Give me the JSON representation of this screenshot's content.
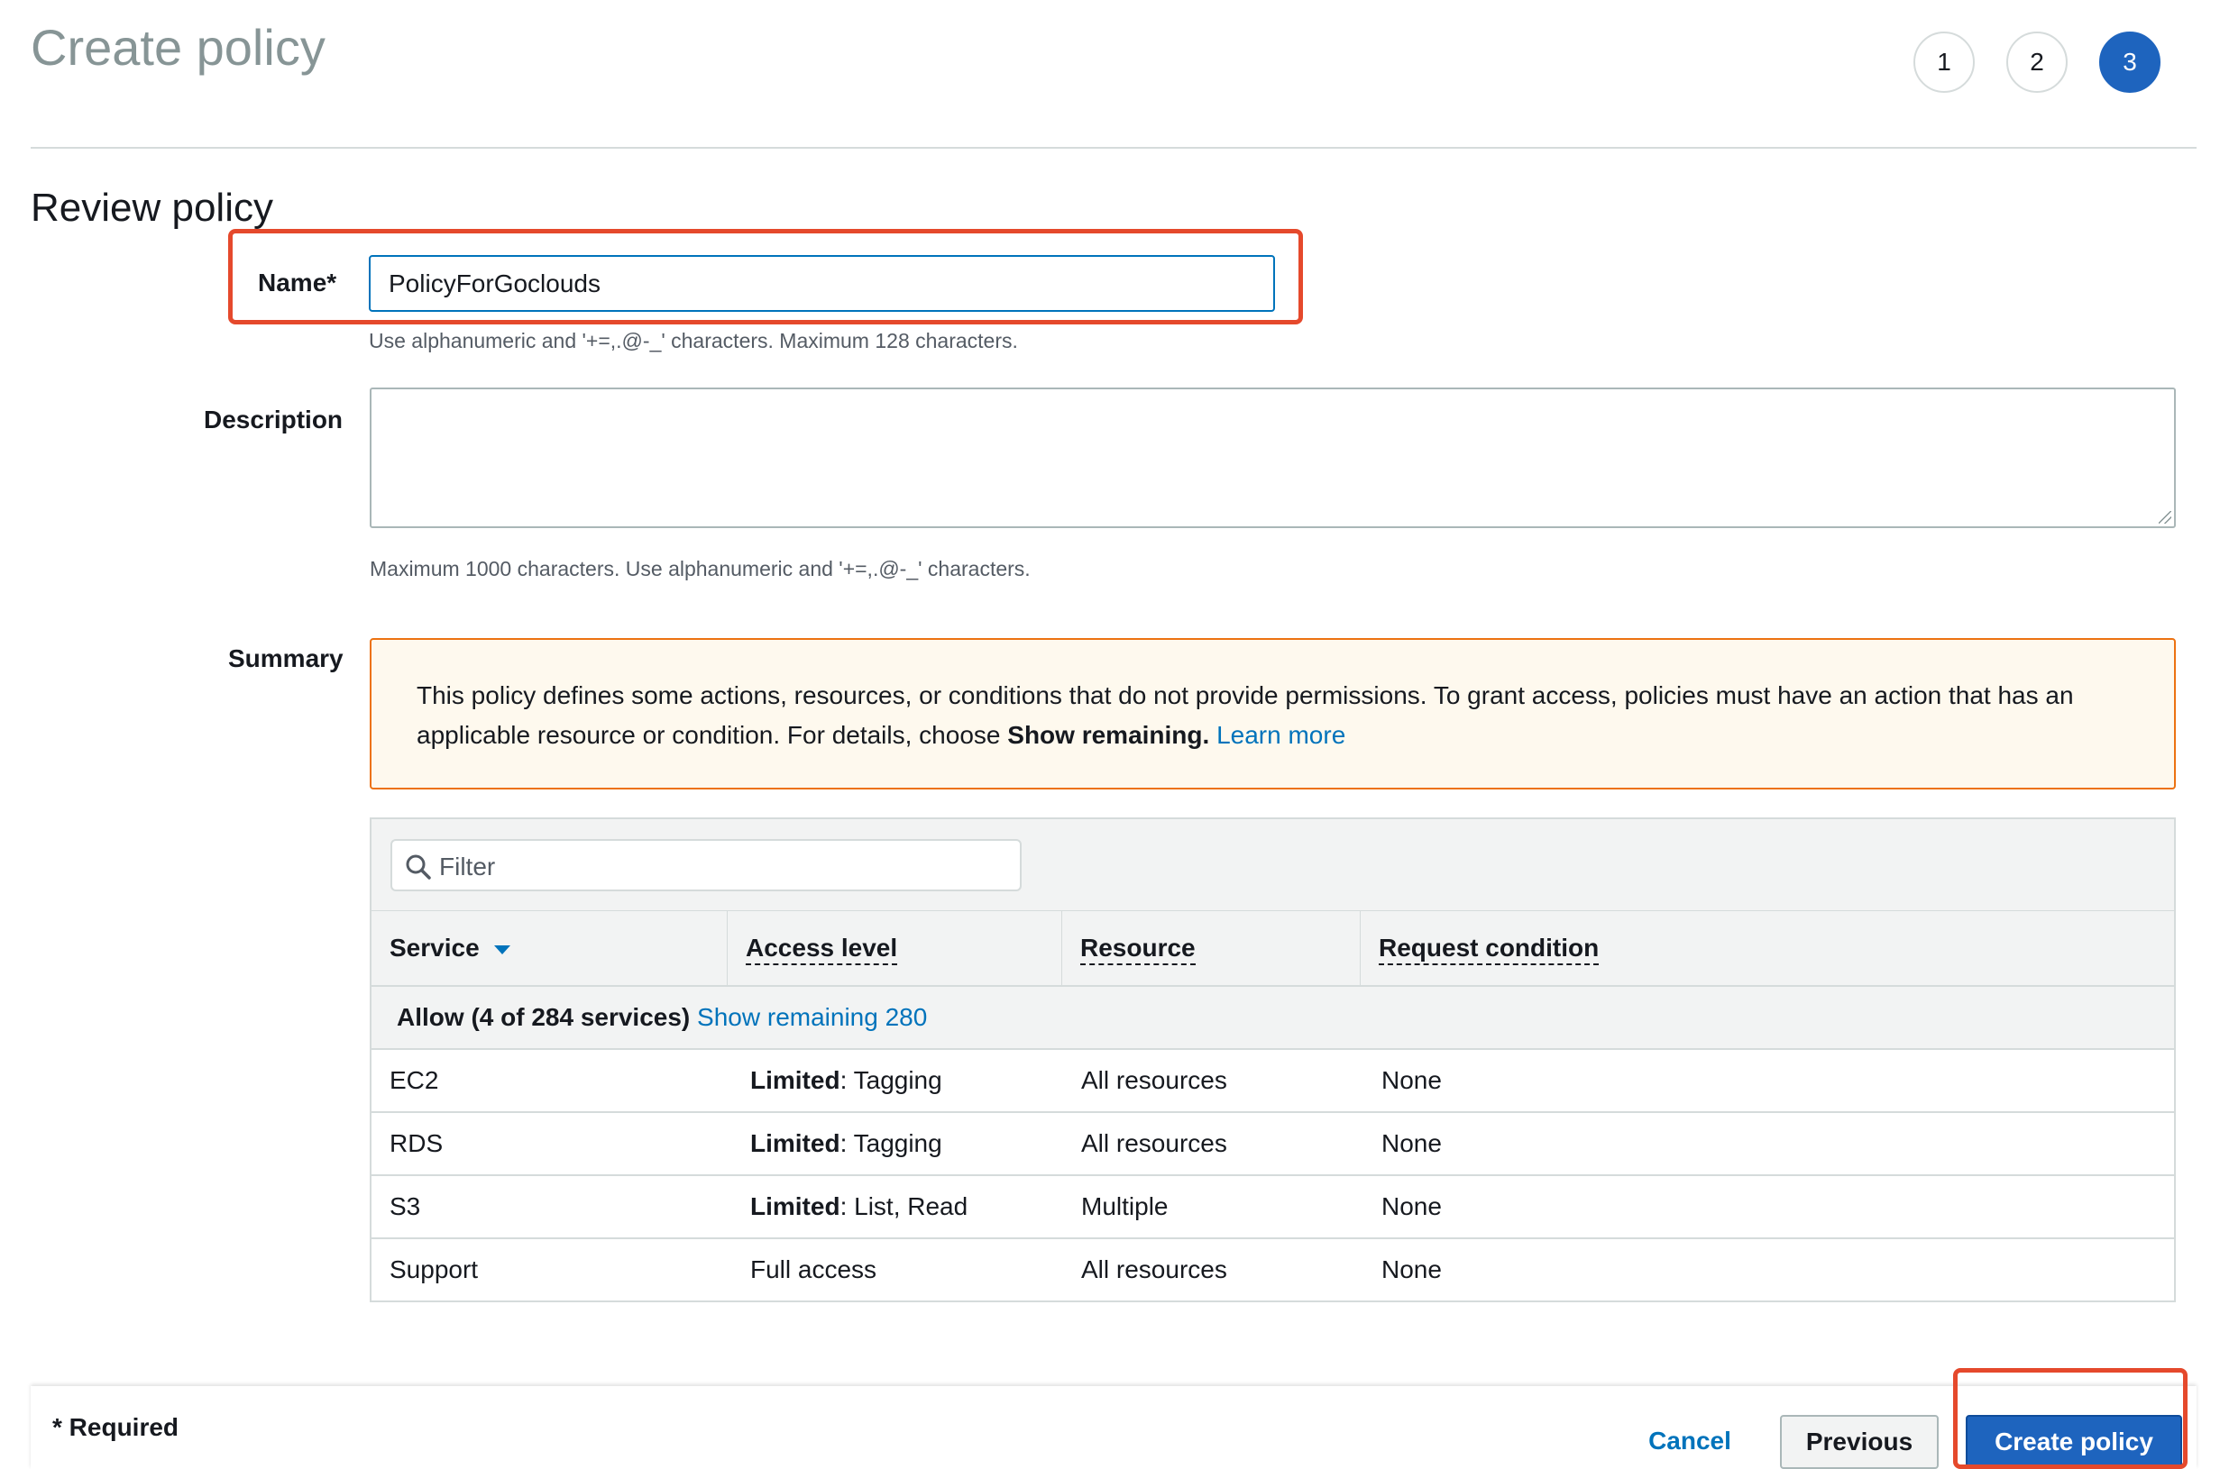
{
  "page": {
    "title": "Create policy"
  },
  "steps": [
    "1",
    "2",
    "3"
  ],
  "active_step": "3",
  "review": {
    "title": "Review policy",
    "name_label": "Name*",
    "name_value": "PolicyForGoclouds",
    "name_hint": "Use alphanumeric and '+=,.@-_' characters. Maximum 128 characters.",
    "description_label": "Description",
    "description_value": "",
    "description_hint": "Maximum 1000 characters. Use alphanumeric and '+=,.@-_' characters.",
    "summary_label": "Summary"
  },
  "warning": {
    "text_before": "This policy defines some actions, resources, or conditions that do not provide permissions. To grant access, policies must have an action that has an applicable resource or condition. For details, choose ",
    "bold": "Show remaining.",
    "link": "Learn more"
  },
  "table": {
    "filter_placeholder": "Filter",
    "columns": [
      "Service",
      "Access level",
      "Resource",
      "Request condition"
    ],
    "group": {
      "label": "Allow (4 of 284 services)",
      "link": "Show remaining 280"
    },
    "rows": [
      {
        "service": "EC2",
        "access_bold": "Limited",
        "access_rest": ": Tagging",
        "resource": "All resources",
        "condition": "None"
      },
      {
        "service": "RDS",
        "access_bold": "Limited",
        "access_rest": ": Tagging",
        "resource": "All resources",
        "condition": "None"
      },
      {
        "service": "S3",
        "access_bold": "Limited",
        "access_rest": ": List, Read",
        "resource": "Multiple",
        "condition": "None"
      },
      {
        "service": "Support",
        "access_bold": "",
        "access_rest": "Full access",
        "resource": "All resources",
        "condition": "None"
      }
    ]
  },
  "footer": {
    "required": "* Required",
    "cancel": "Cancel",
    "previous": "Previous",
    "create": "Create policy"
  },
  "colors": {
    "primary": "#1e64be",
    "link": "#0073bb",
    "highlight": "#e5492c",
    "warning_border": "#ec7211",
    "warning_bg": "#fef9ee"
  }
}
